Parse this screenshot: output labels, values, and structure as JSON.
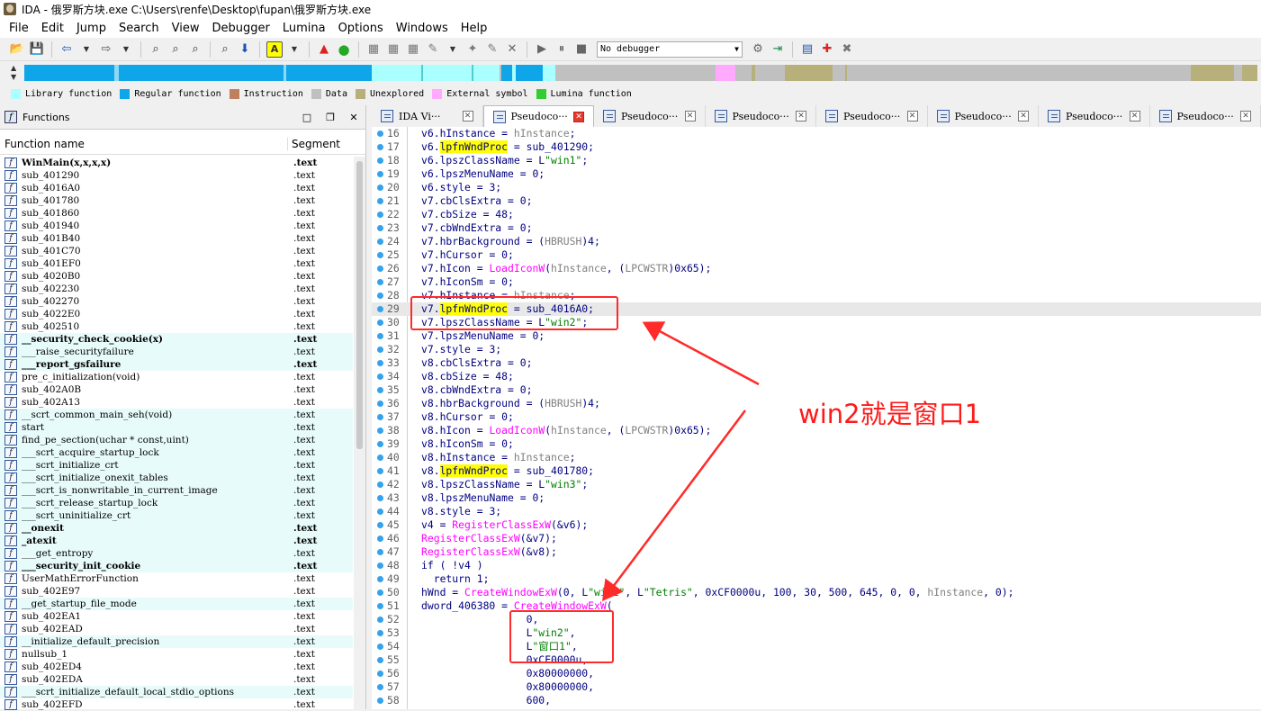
{
  "window": {
    "title": "IDA - 俄罗斯方块.exe C:\\Users\\renfe\\Desktop\\fupan\\俄罗斯方块.exe"
  },
  "menu": [
    "File",
    "Edit",
    "Jump",
    "Search",
    "View",
    "Debugger",
    "Lumina",
    "Options",
    "Windows",
    "Help"
  ],
  "toolbar": {
    "debugger_select": "No debugger"
  },
  "legend": [
    {
      "label": "Library function",
      "color": "#aaffff"
    },
    {
      "label": "Regular function",
      "color": "#0ea5e9"
    },
    {
      "label": "Instruction",
      "color": "#c08060"
    },
    {
      "label": "Data",
      "color": "#c0c0c0"
    },
    {
      "label": "Unexplored",
      "color": "#b8b07a"
    },
    {
      "label": "External symbol",
      "color": "#ffaaff"
    },
    {
      "label": "Lumina function",
      "color": "#33cc33"
    }
  ],
  "functions_panel": {
    "title": "Functions",
    "col_name": "Function name",
    "col_segment": "Segment",
    "rows": [
      {
        "name": "WinMain(x,x,x,x)",
        "seg": ".text",
        "lib": false,
        "bold": true
      },
      {
        "name": "sub_401290",
        "seg": ".text",
        "lib": false,
        "bold": false
      },
      {
        "name": "sub_4016A0",
        "seg": ".text",
        "lib": false,
        "bold": false
      },
      {
        "name": "sub_401780",
        "seg": ".text",
        "lib": false,
        "bold": false
      },
      {
        "name": "sub_401860",
        "seg": ".text",
        "lib": false,
        "bold": false
      },
      {
        "name": "sub_401940",
        "seg": ".text",
        "lib": false,
        "bold": false
      },
      {
        "name": "sub_401B40",
        "seg": ".text",
        "lib": false,
        "bold": false
      },
      {
        "name": "sub_401C70",
        "seg": ".text",
        "lib": false,
        "bold": false
      },
      {
        "name": "sub_401EF0",
        "seg": ".text",
        "lib": false,
        "bold": false
      },
      {
        "name": "sub_4020B0",
        "seg": ".text",
        "lib": false,
        "bold": false
      },
      {
        "name": "sub_402230",
        "seg": ".text",
        "lib": false,
        "bold": false
      },
      {
        "name": "sub_402270",
        "seg": ".text",
        "lib": false,
        "bold": false
      },
      {
        "name": "sub_4022E0",
        "seg": ".text",
        "lib": false,
        "bold": false
      },
      {
        "name": "sub_402510",
        "seg": ".text",
        "lib": false,
        "bold": false
      },
      {
        "name": "__security_check_cookie(x)",
        "seg": ".text",
        "lib": true,
        "bold": true
      },
      {
        "name": "___raise_securityfailure",
        "seg": ".text",
        "lib": true,
        "bold": false
      },
      {
        "name": "___report_gsfailure",
        "seg": ".text",
        "lib": true,
        "bold": true
      },
      {
        "name": "pre_c_initialization(void)",
        "seg": ".text",
        "lib": false,
        "bold": false
      },
      {
        "name": "sub_402A0B",
        "seg": ".text",
        "lib": false,
        "bold": false
      },
      {
        "name": "sub_402A13",
        "seg": ".text",
        "lib": false,
        "bold": false
      },
      {
        "name": "__scrt_common_main_seh(void)",
        "seg": ".text",
        "lib": true,
        "bold": false
      },
      {
        "name": "start",
        "seg": ".text",
        "lib": true,
        "bold": false
      },
      {
        "name": "find_pe_section(uchar * const,uint)",
        "seg": ".text",
        "lib": true,
        "bold": false
      },
      {
        "name": "___scrt_acquire_startup_lock",
        "seg": ".text",
        "lib": true,
        "bold": false
      },
      {
        "name": "___scrt_initialize_crt",
        "seg": ".text",
        "lib": true,
        "bold": false
      },
      {
        "name": "___scrt_initialize_onexit_tables",
        "seg": ".text",
        "lib": true,
        "bold": false
      },
      {
        "name": "___scrt_is_nonwritable_in_current_image",
        "seg": ".text",
        "lib": true,
        "bold": false
      },
      {
        "name": "___scrt_release_startup_lock",
        "seg": ".text",
        "lib": true,
        "bold": false
      },
      {
        "name": "___scrt_uninitialize_crt",
        "seg": ".text",
        "lib": true,
        "bold": false
      },
      {
        "name": "__onexit",
        "seg": ".text",
        "lib": true,
        "bold": true
      },
      {
        "name": "_atexit",
        "seg": ".text",
        "lib": true,
        "bold": true
      },
      {
        "name": "___get_entropy",
        "seg": ".text",
        "lib": true,
        "bold": false
      },
      {
        "name": "___security_init_cookie",
        "seg": ".text",
        "lib": true,
        "bold": true
      },
      {
        "name": "UserMathErrorFunction",
        "seg": ".text",
        "lib": false,
        "bold": false
      },
      {
        "name": "sub_402E97",
        "seg": ".text",
        "lib": false,
        "bold": false
      },
      {
        "name": "__get_startup_file_mode",
        "seg": ".text",
        "lib": true,
        "bold": false
      },
      {
        "name": "sub_402EA1",
        "seg": ".text",
        "lib": false,
        "bold": false
      },
      {
        "name": "sub_402EAD",
        "seg": ".text",
        "lib": false,
        "bold": false
      },
      {
        "name": "__initialize_default_precision",
        "seg": ".text",
        "lib": true,
        "bold": false
      },
      {
        "name": "nullsub_1",
        "seg": ".text",
        "lib": false,
        "bold": false
      },
      {
        "name": "sub_402ED4",
        "seg": ".text",
        "lib": false,
        "bold": false
      },
      {
        "name": "sub_402EDA",
        "seg": ".text",
        "lib": false,
        "bold": false
      },
      {
        "name": "___scrt_initialize_default_local_stdio_options",
        "seg": ".text",
        "lib": true,
        "bold": false
      },
      {
        "name": "sub_402EFD",
        "seg": ".text",
        "lib": false,
        "bold": false
      }
    ]
  },
  "tabs": [
    "IDA Vi···",
    "Pseudoco···",
    "Pseudoco···",
    "Pseudoco···",
    "Pseudoco···",
    "Pseudoco···",
    "Pseudoco···",
    "Pseudoco···"
  ],
  "code": [
    {
      "n": "16",
      "hl": false,
      "html": "<span class='cv'>v6</span>.hInstance = <span class='cg'>hInstance</span>;"
    },
    {
      "n": "17",
      "hl": false,
      "html": "<span class='cv'>v6</span>.<span class='cy'>lpfnWndProc</span> = sub_401290;"
    },
    {
      "n": "18",
      "hl": false,
      "html": "<span class='cv'>v6</span>.lpszClassName = L<span class='cs'>\"win1\"</span>;"
    },
    {
      "n": "19",
      "hl": false,
      "html": "<span class='cv'>v6</span>.lpszMenuName = 0;"
    },
    {
      "n": "20",
      "hl": false,
      "html": "<span class='cv'>v6</span>.style = 3;"
    },
    {
      "n": "21",
      "hl": false,
      "html": "<span class='cv'>v7</span>.cbClsExtra = 0;"
    },
    {
      "n": "22",
      "hl": false,
      "html": "<span class='cv'>v7</span>.cbSize = 48;"
    },
    {
      "n": "23",
      "hl": false,
      "html": "<span class='cv'>v7</span>.cbWndExtra = 0;"
    },
    {
      "n": "24",
      "hl": false,
      "html": "<span class='cv'>v7</span>.hbrBackground = (<span class='cg'>HBRUSH</span>)4;"
    },
    {
      "n": "25",
      "hl": false,
      "html": "<span class='cv'>v7</span>.hCursor = 0;"
    },
    {
      "n": "26",
      "hl": false,
      "html": "<span class='cv'>v7</span>.hIcon = <span class='cf'>LoadIconW</span>(<span class='cg'>hInstance</span>, (<span class='cg'>LPCWSTR</span>)0x65);"
    },
    {
      "n": "27",
      "hl": false,
      "html": "<span class='cv'>v7</span>.hIconSm = 0;"
    },
    {
      "n": "28",
      "hl": false,
      "html": "<span class='cv'>v7</span>.hInstance = <span class='cg'>hInstance</span>;"
    },
    {
      "n": "29",
      "hl": true,
      "html": "<span class='cv'>v7</span>.<span class='cy'>lpfnWndProc</span> = sub_4016A0;"
    },
    {
      "n": "30",
      "hl": false,
      "html": "<span class='cv'>v7</span>.lpszClassName = L<span class='cs'>\"win2\"</span>;"
    },
    {
      "n": "31",
      "hl": false,
      "html": "<span class='cv'>v7</span>.lpszMenuName = 0;"
    },
    {
      "n": "32",
      "hl": false,
      "html": "<span class='cv'>v7</span>.style = 3;"
    },
    {
      "n": "33",
      "hl": false,
      "html": "<span class='cv'>v8</span>.cbClsExtra = 0;"
    },
    {
      "n": "34",
      "hl": false,
      "html": "<span class='cv'>v8</span>.cbSize = 48;"
    },
    {
      "n": "35",
      "hl": false,
      "html": "<span class='cv'>v8</span>.cbWndExtra = 0;"
    },
    {
      "n": "36",
      "hl": false,
      "html": "<span class='cv'>v8</span>.hbrBackground = (<span class='cg'>HBRUSH</span>)4;"
    },
    {
      "n": "37",
      "hl": false,
      "html": "<span class='cv'>v8</span>.hCursor = 0;"
    },
    {
      "n": "38",
      "hl": false,
      "html": "<span class='cv'>v8</span>.hIcon = <span class='cf'>LoadIconW</span>(<span class='cg'>hInstance</span>, (<span class='cg'>LPCWSTR</span>)0x65);"
    },
    {
      "n": "39",
      "hl": false,
      "html": "<span class='cv'>v8</span>.hIconSm = 0;"
    },
    {
      "n": "40",
      "hl": false,
      "html": "<span class='cv'>v8</span>.hInstance = <span class='cg'>hInstance</span>;"
    },
    {
      "n": "41",
      "hl": false,
      "html": "<span class='cv'>v8</span>.<span class='cy'>lpfnWndProc</span> = sub_401780;"
    },
    {
      "n": "42",
      "hl": false,
      "html": "<span class='cv'>v8</span>.lpszClassName = L<span class='cs'>\"win3\"</span>;"
    },
    {
      "n": "43",
      "hl": false,
      "html": "<span class='cv'>v8</span>.lpszMenuName = 0;"
    },
    {
      "n": "44",
      "hl": false,
      "html": "<span class='cv'>v8</span>.style = 3;"
    },
    {
      "n": "45",
      "hl": false,
      "html": "v4 = <span class='cf'>RegisterClassExW</span>(&amp;<span class='cv'>v6</span>);"
    },
    {
      "n": "46",
      "hl": false,
      "html": "<span class='cf'>RegisterClassExW</span>(&amp;<span class='cv'>v7</span>);"
    },
    {
      "n": "47",
      "hl": false,
      "html": "<span class='cf'>RegisterClassExW</span>(&amp;<span class='cv'>v8</span>);"
    },
    {
      "n": "48",
      "hl": false,
      "html": "if ( !v4 )"
    },
    {
      "n": "49",
      "hl": false,
      "html": "  return 1;"
    },
    {
      "n": "50",
      "hl": false,
      "html": "hWnd = <span class='cf'>CreateWindowExW</span>(0, L<span class='cs'>\"win1\"</span>, L<span class='cs'>\"Tetris\"</span>, 0xCF0000u, 100, 30, 500, 645, 0, 0, <span class='cg'>hInstance</span>, 0);"
    },
    {
      "n": "51",
      "hl": false,
      "html": "dword_406380 = <span class='cf'>CreateWindowExW</span>("
    },
    {
      "n": "52",
      "hl": false,
      "html": "                 0,"
    },
    {
      "n": "53",
      "hl": false,
      "html": "                 L<span class='cs'>\"win2\"</span>,"
    },
    {
      "n": "54",
      "hl": false,
      "html": "                 L<span class='cs'>\"窗口1\"</span>,"
    },
    {
      "n": "55",
      "hl": false,
      "html": "                 0xCF0000u,"
    },
    {
      "n": "56",
      "hl": false,
      "html": "                 0x80000000,"
    },
    {
      "n": "57",
      "hl": false,
      "html": "                 0x80000000,"
    },
    {
      "n": "58",
      "hl": false,
      "html": "                 600,"
    }
  ],
  "annotation": {
    "text": "win2就是窗口1",
    "color": "#ff1a1a"
  }
}
